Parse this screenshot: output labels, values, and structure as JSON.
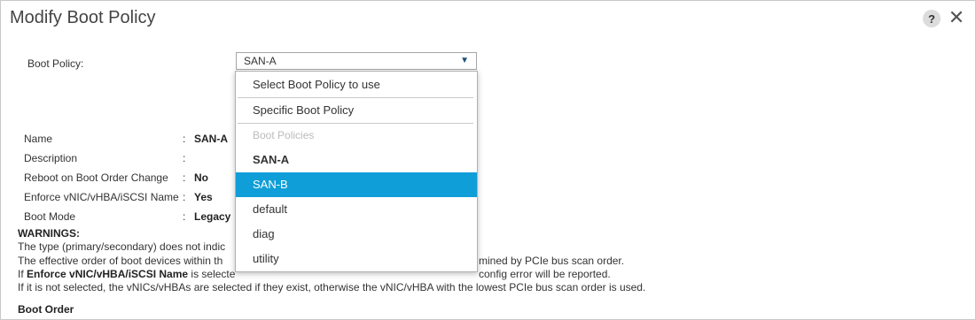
{
  "dialog": {
    "title": "Modify Boot Policy",
    "help_label": "?",
    "close_label": "✕"
  },
  "boot_policy": {
    "label": "Boot Policy:",
    "selected": "SAN-A",
    "arrow": "▼"
  },
  "dropdown": {
    "options": [
      "Select Boot Policy to use",
      "Specific Boot Policy",
      "Boot Policies",
      "SAN-A",
      "SAN-B",
      "default",
      "diag",
      "utility"
    ]
  },
  "details": {
    "name": {
      "label": "Name",
      "value": "SAN-A"
    },
    "description": {
      "label": "Description",
      "value": ""
    },
    "reboot": {
      "label": "Reboot on Boot Order Change",
      "value": "No"
    },
    "enforce": {
      "label": "Enforce vNIC/vHBA/iSCSI Name",
      "value": "Yes"
    },
    "boot_mode": {
      "label": "Boot Mode",
      "value": "Legacy"
    },
    "separator": ":"
  },
  "warnings": {
    "title": "WARNINGS:",
    "line1": "The type (primary/secondary) does not indic",
    "line2a": "The effective order of boot devices within th",
    "line2b": "mined by PCIe bus scan order.",
    "line3_prefix": "If ",
    "line3_bold": "Enforce vNIC/vHBA/iSCSI Name",
    "line3_mid": " is selecte",
    "line3_end": "config error will be reported.",
    "line4": "If it is not selected, the vNICs/vHBAs are selected if they exist, otherwise the vNIC/vHBA with the lowest PCIe bus scan order is used."
  },
  "boot_order_title": "Boot Order"
}
